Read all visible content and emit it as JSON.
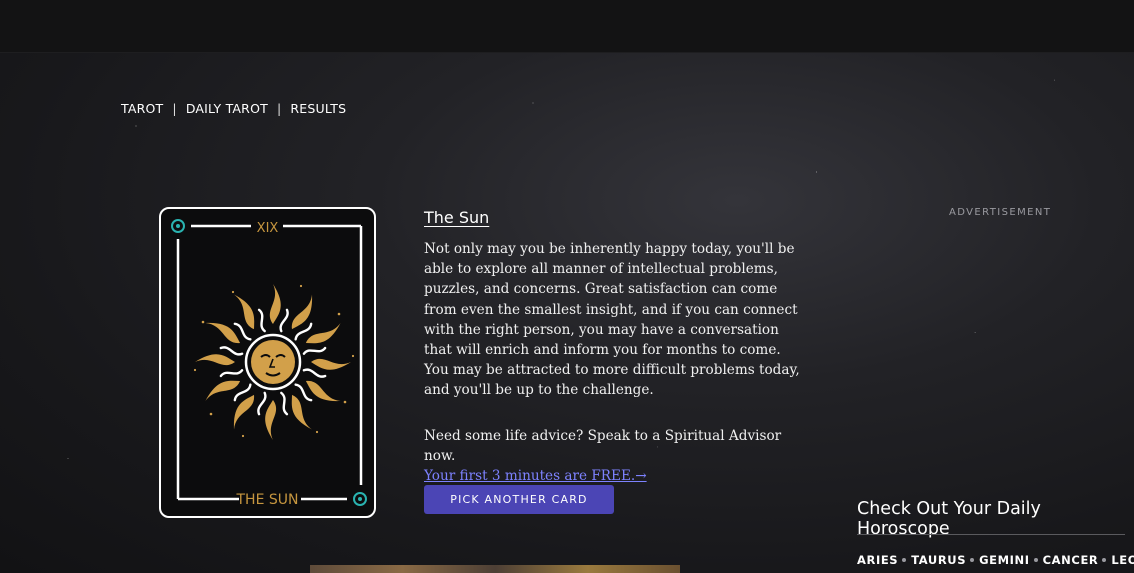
{
  "breadcrumb": [
    {
      "label": "TAROT"
    },
    {
      "label": "DAILY TAROT"
    },
    {
      "label": "RESULTS"
    }
  ],
  "card": {
    "numeral": "XIX",
    "name": "THE SUN",
    "colors": {
      "gold": "#c6963f",
      "teal": "#2ab3b0",
      "border": "#ffffff"
    },
    "icon": "sun-face-icon"
  },
  "description": {
    "title": "The Sun",
    "body": "Not only may you be inherently happy today, you'll be able to explore all manner of intellectual problems, puzzles, and concerns. Great satisfaction can come from even the smallest insight, and if you can connect with the right person, you may have a conversation that will enrich and inform you for months to come. You may be attracted to more difficult problems today, and you'll be up to the challenge."
  },
  "advice": {
    "text": "Need some life advice? Speak to a Spiritual Advisor now.",
    "link": "Your first 3 minutes are FREE.→"
  },
  "pick_button": "PICK ANOTHER CARD",
  "ad_label": "ADVERTISEMENT",
  "horoscope": {
    "title": "Check Out Your Daily Horoscope",
    "signs": [
      "ARIES",
      "TAURUS",
      "GEMINI",
      "CANCER",
      "LEO"
    ]
  },
  "colors": {
    "accent_button": "#4b45b5",
    "link": "#7d82ff"
  }
}
